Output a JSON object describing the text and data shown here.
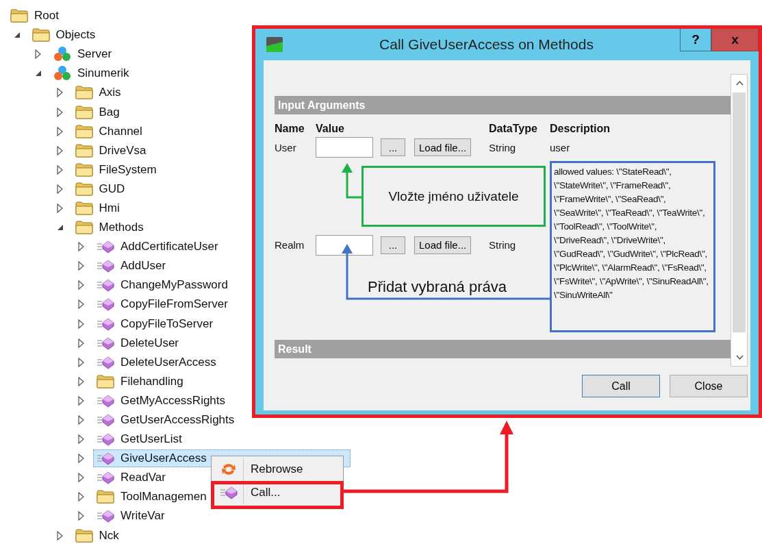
{
  "tree": [
    {
      "label": "Root",
      "kind": "folder",
      "selected": false,
      "children": [
        {
          "label": "Objects",
          "kind": "folder",
          "expanded": true,
          "selected": false,
          "children": [
            {
              "label": "Server",
              "kind": "object",
              "expanded": false,
              "selected": false
            },
            {
              "label": "Sinumerik",
              "kind": "object",
              "expanded": true,
              "selected": false,
              "children": [
                {
                  "label": "Axis",
                  "kind": "folder",
                  "expanded": false,
                  "selected": false
                },
                {
                  "label": "Bag",
                  "kind": "folder",
                  "expanded": false,
                  "selected": false
                },
                {
                  "label": "Channel",
                  "kind": "folder",
                  "expanded": false,
                  "selected": false
                },
                {
                  "label": "DriveVsa",
                  "kind": "folder",
                  "expanded": false,
                  "selected": false
                },
                {
                  "label": "FileSystem",
                  "kind": "folder",
                  "expanded": false,
                  "selected": false
                },
                {
                  "label": "GUD",
                  "kind": "folder",
                  "expanded": false,
                  "selected": false
                },
                {
                  "label": "Hmi",
                  "kind": "folder",
                  "expanded": false,
                  "selected": false
                },
                {
                  "label": "Methods",
                  "kind": "folder",
                  "expanded": true,
                  "selected": false,
                  "children": [
                    {
                      "label": "AddCertificateUser",
                      "kind": "method",
                      "expanded": false,
                      "selected": false
                    },
                    {
                      "label": "AddUser",
                      "kind": "method",
                      "expanded": false,
                      "selected": false
                    },
                    {
                      "label": "ChangeMyPassword",
                      "kind": "method",
                      "expanded": false,
                      "selected": false
                    },
                    {
                      "label": "CopyFileFromServer",
                      "kind": "method",
                      "expanded": false,
                      "selected": false
                    },
                    {
                      "label": "CopyFileToServer",
                      "kind": "method",
                      "expanded": false,
                      "selected": false
                    },
                    {
                      "label": "DeleteUser",
                      "kind": "method",
                      "expanded": false,
                      "selected": false
                    },
                    {
                      "label": "DeleteUserAccess",
                      "kind": "method",
                      "expanded": false,
                      "selected": false
                    },
                    {
                      "label": "Filehandling",
                      "kind": "folder",
                      "expanded": false,
                      "selected": false
                    },
                    {
                      "label": "GetMyAccessRights",
                      "kind": "method",
                      "expanded": false,
                      "selected": false
                    },
                    {
                      "label": "GetUserAccessRights",
                      "kind": "method",
                      "expanded": false,
                      "selected": false
                    },
                    {
                      "label": "GetUserList",
                      "kind": "method",
                      "expanded": false,
                      "selected": false
                    },
                    {
                      "label": "GiveUserAccess",
                      "kind": "method",
                      "expanded": false,
                      "selected": true
                    },
                    {
                      "label": "ReadVar",
                      "kind": "method",
                      "expanded": false,
                      "selected": false
                    },
                    {
                      "label": "ToolManagemen",
                      "kind": "folder",
                      "expanded": false,
                      "selected": false
                    },
                    {
                      "label": "WriteVar",
                      "kind": "method",
                      "expanded": false,
                      "selected": false
                    }
                  ]
                },
                {
                  "label": "Nck",
                  "kind": "folder",
                  "expanded": false,
                  "selected": false
                }
              ]
            }
          ]
        }
      ]
    }
  ],
  "context_menu": [
    {
      "label": "Rebrowse",
      "kind": "refresh"
    },
    {
      "label": "Call...",
      "kind": "method"
    }
  ],
  "dialog": {
    "title": "Call GiveUserAccess on Methods",
    "help_button": "?",
    "close_button": "x",
    "input_header": "Input Arguments",
    "columns": [
      "Name",
      "Value",
      "",
      "",
      "DataType",
      "Description"
    ],
    "arguments": [
      {
        "name": "User",
        "browse_button": "...",
        "load_button": "Load file...",
        "datatype": "String",
        "description": "user"
      },
      {
        "name": "Realm",
        "browse_button": "...",
        "load_button": "Load file...",
        "datatype": "String",
        "description": "allowed values: \\\"StateRead\\\", \\\"StateWrite\\\", \\\"FrameRead\\\", \\\"FrameWrite\\\", \\\"SeaRead\\\", \\\"SeaWrite\\\", \\\"TeaRead\\\", \\\"TeaWrite\\\", \\\"ToolRead\\\", \\\"ToolWrite\\\", \\\"DriveRead\\\", \\\"DriveWrite\\\", \\\"GudRead\\\", \\\"GudWrite\\\", \\\"PlcRead\\\", \\\"PlcWrite\\\", \\\"AlarmRead\\\", \\\"FsRead\\\", \\\"FsWrite\\\", \\\"ApWrite\\\", \\\"SinuReadAll\\\", \\\"SinuWriteAll\\\""
      }
    ],
    "result_header": "Result",
    "buttons": [
      "Call",
      "Close"
    ]
  },
  "annotations": [
    {
      "kind": "box",
      "text": "Vložte jméno uživatele"
    },
    {
      "kind": "label",
      "text": "Přidat vybraná práva"
    }
  ]
}
